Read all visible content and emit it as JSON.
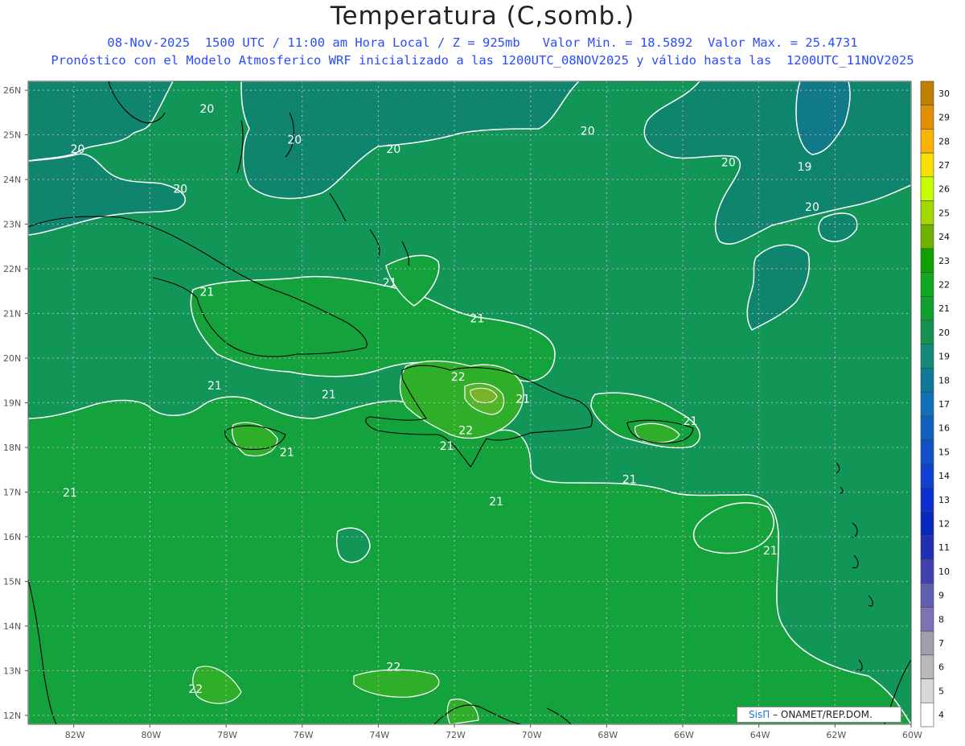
{
  "title": "Temperatura (C,somb.)",
  "subtitle_line1": "08-Nov-2025  1500 UTC / 11:00 am Hora Local / Z = 925mb   Valor Min. = 18.5892  Valor Max. = 25.4731",
  "subtitle_line2": "Pronóstico con el Modelo Atmosferico WRF inicializado a las 1200UTC_08NOV2025 y válido hasta las  1200UTC_11NOV2025",
  "credit": {
    "brand": "SisΠ",
    "text": "– ONAMET/REP.DOM."
  },
  "map": {
    "lat_ticks": [
      "26N",
      "25N",
      "24N",
      "23N",
      "22N",
      "21N",
      "20N",
      "19N",
      "18N",
      "17N",
      "16N",
      "15N",
      "14N",
      "13N",
      "12N"
    ],
    "lon_ticks": [
      "82W",
      "80W",
      "78W",
      "76W",
      "74W",
      "72W",
      "70W",
      "68W",
      "66W",
      "64W",
      "62W",
      "60W"
    ],
    "contour_labels": [
      {
        "text": "20",
        "lon": -78.5,
        "lat": 25.5
      },
      {
        "text": "20",
        "lon": -81.9,
        "lat": 24.6
      },
      {
        "text": "20",
        "lon": -76.2,
        "lat": 24.8
      },
      {
        "text": "20",
        "lon": -73.6,
        "lat": 24.6
      },
      {
        "text": "20",
        "lon": -79.2,
        "lat": 23.7
      },
      {
        "text": "20",
        "lon": -68.5,
        "lat": 25.0
      },
      {
        "text": "20",
        "lon": -64.8,
        "lat": 24.3
      },
      {
        "text": "19",
        "lon": -62.8,
        "lat": 24.2
      },
      {
        "text": "20",
        "lon": -62.6,
        "lat": 23.3
      },
      {
        "text": "21",
        "lon": -73.7,
        "lat": 21.6
      },
      {
        "text": "21",
        "lon": -78.5,
        "lat": 21.4
      },
      {
        "text": "21",
        "lon": -71.4,
        "lat": 20.8
      },
      {
        "text": "22",
        "lon": -71.9,
        "lat": 19.5
      },
      {
        "text": "21",
        "lon": -78.3,
        "lat": 19.3
      },
      {
        "text": "21",
        "lon": -75.3,
        "lat": 19.1
      },
      {
        "text": "21",
        "lon": -70.2,
        "lat": 19.0
      },
      {
        "text": "21",
        "lon": -65.8,
        "lat": 18.5
      },
      {
        "text": "22",
        "lon": -71.7,
        "lat": 18.3
      },
      {
        "text": "21",
        "lon": -72.2,
        "lat": 17.95
      },
      {
        "text": "21",
        "lon": -76.4,
        "lat": 17.8
      },
      {
        "text": "21",
        "lon": -67.4,
        "lat": 17.2
      },
      {
        "text": "21",
        "lon": -70.9,
        "lat": 16.7
      },
      {
        "text": "21",
        "lon": -82.1,
        "lat": 16.9
      },
      {
        "text": "21",
        "lon": -63.7,
        "lat": 15.6
      },
      {
        "text": "22",
        "lon": -73.6,
        "lat": 13.0
      },
      {
        "text": "22",
        "lon": -78.8,
        "lat": 12.5
      }
    ]
  },
  "colorbar": {
    "levels": [
      "30",
      "29",
      "28",
      "27",
      "26",
      "25",
      "24",
      "23",
      "22",
      "21",
      "20",
      "19",
      "18",
      "17",
      "16",
      "15",
      "14",
      "13",
      "12",
      "11",
      "10",
      "9",
      "8",
      "7",
      "6",
      "5",
      "4"
    ],
    "colors": [
      "#c08000",
      "#e09000",
      "#f8b400",
      "#f8e000",
      "#c8ff00",
      "#a0d800",
      "#70b000",
      "#10a000",
      "#10a820",
      "#10a030",
      "#149050",
      "#148878",
      "#107898",
      "#1070b8",
      "#1060c0",
      "#1050c8",
      "#1040d0",
      "#0c30d0",
      "#0828c0",
      "#2030b0",
      "#4040b0",
      "#6060b0",
      "#8070b8",
      "#a0a0a8",
      "#b8b8b8",
      "#d8d8d8",
      "#ffffff"
    ]
  }
}
